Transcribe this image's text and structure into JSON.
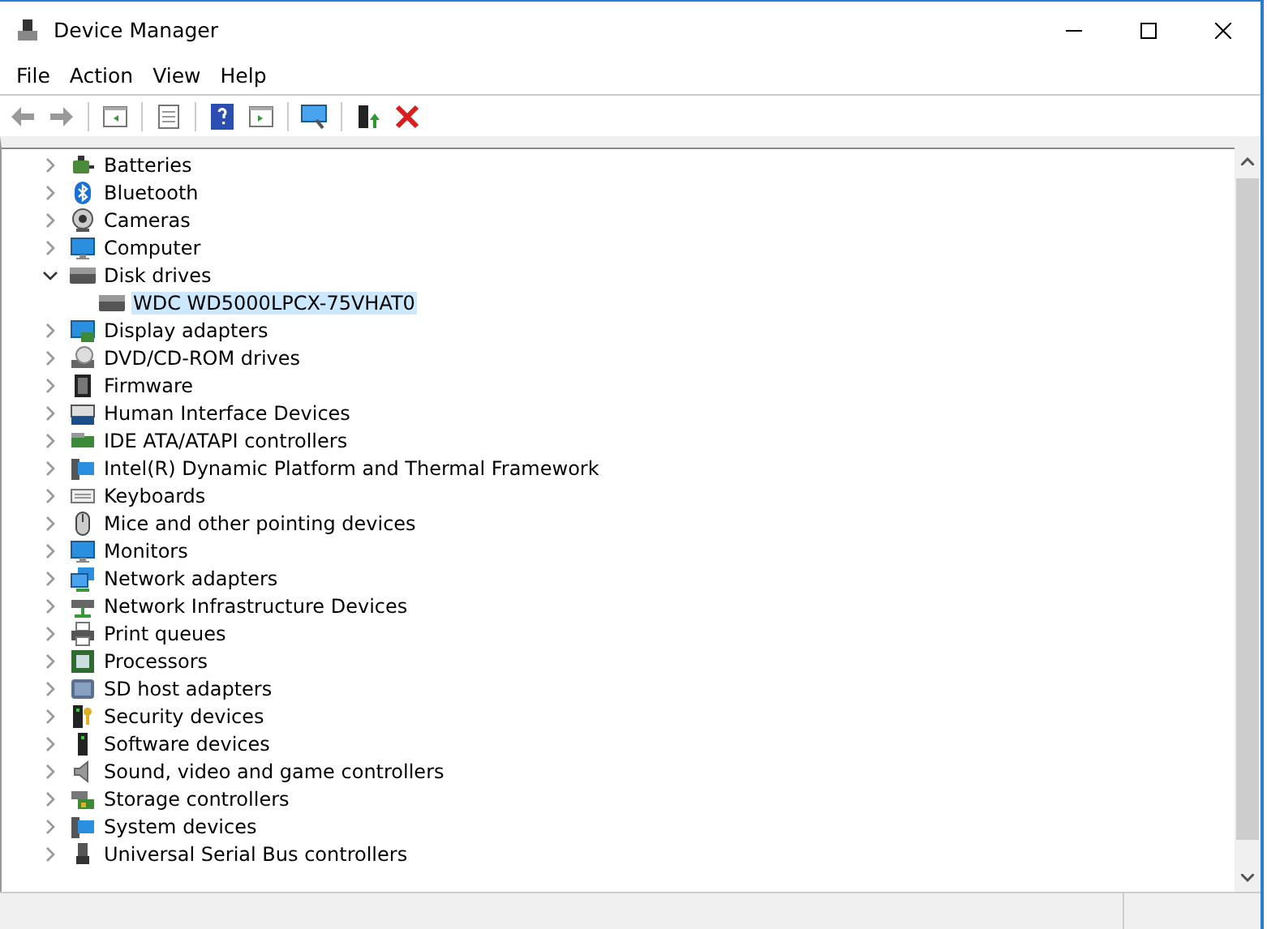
{
  "window": {
    "title": "Device Manager"
  },
  "menu": [
    "File",
    "Action",
    "View",
    "Help"
  ],
  "tree": [
    {
      "label": "Batteries",
      "expanded": false
    },
    {
      "label": "Bluetooth",
      "expanded": false
    },
    {
      "label": "Cameras",
      "expanded": false
    },
    {
      "label": "Computer",
      "expanded": false
    },
    {
      "label": "Disk drives",
      "expanded": true,
      "children": [
        {
          "label": "WDC WD5000LPCX-75VHAT0",
          "selected": true
        }
      ]
    },
    {
      "label": "Display adapters",
      "expanded": false
    },
    {
      "label": "DVD/CD-ROM drives",
      "expanded": false
    },
    {
      "label": "Firmware",
      "expanded": false
    },
    {
      "label": "Human Interface Devices",
      "expanded": false
    },
    {
      "label": "IDE ATA/ATAPI controllers",
      "expanded": false
    },
    {
      "label": "Intel(R) Dynamic Platform and Thermal Framework",
      "expanded": false
    },
    {
      "label": "Keyboards",
      "expanded": false
    },
    {
      "label": "Mice and other pointing devices",
      "expanded": false
    },
    {
      "label": "Monitors",
      "expanded": false
    },
    {
      "label": "Network adapters",
      "expanded": false
    },
    {
      "label": "Network Infrastructure Devices",
      "expanded": false
    },
    {
      "label": "Print queues",
      "expanded": false
    },
    {
      "label": "Processors",
      "expanded": false
    },
    {
      "label": "SD host adapters",
      "expanded": false
    },
    {
      "label": "Security devices",
      "expanded": false
    },
    {
      "label": "Software devices",
      "expanded": false
    },
    {
      "label": "Sound, video and game controllers",
      "expanded": false
    },
    {
      "label": "Storage controllers",
      "expanded": false
    },
    {
      "label": "System devices",
      "expanded": false
    },
    {
      "label": "Universal Serial Bus controllers",
      "expanded": false
    }
  ]
}
